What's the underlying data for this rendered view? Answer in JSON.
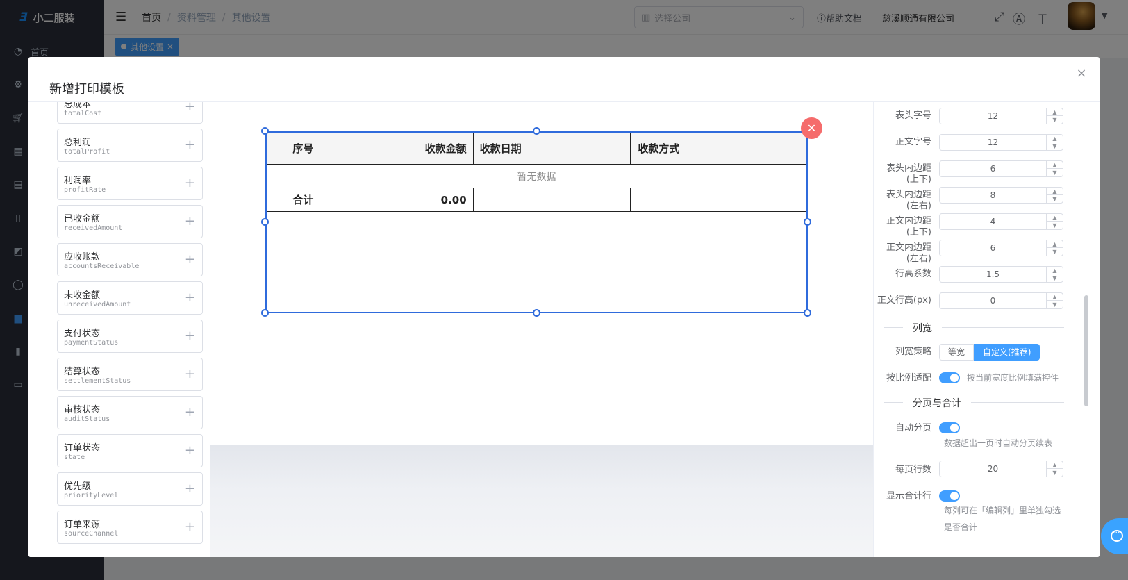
{
  "app": {
    "logo_mark": "Ǝ",
    "name": "小二服装"
  },
  "sidebar": {
    "first_item": "首页"
  },
  "breadcrumb": [
    "首页",
    "资料管理",
    "其他设置"
  ],
  "header": {
    "company_placeholder": "选择公司",
    "help_label": "帮助文档",
    "company_name": "慈溪顺通有限公司"
  },
  "tags": [
    {
      "label": "其他设置",
      "close": "×"
    }
  ],
  "dialog": {
    "title": "新增打印模板",
    "close": "×"
  },
  "fields": [
    {
      "label": "总成本",
      "key": "totalCost"
    },
    {
      "label": "总利润",
      "key": "totalProfit"
    },
    {
      "label": "利润率",
      "key": "profitRate"
    },
    {
      "label": "已收金额",
      "key": "receivedAmount"
    },
    {
      "label": "应收账款",
      "key": "accountsReceivable"
    },
    {
      "label": "未收金额",
      "key": "unreceivedAmount"
    },
    {
      "label": "支付状态",
      "key": "paymentStatus"
    },
    {
      "label": "结算状态",
      "key": "settlementStatus"
    },
    {
      "label": "审核状态",
      "key": "auditStatus"
    },
    {
      "label": "订单状态",
      "key": "state"
    },
    {
      "label": "优先级",
      "key": "priorityLevel"
    },
    {
      "label": "订单来源",
      "key": "sourceChannel"
    }
  ],
  "table": {
    "headers": [
      "序号",
      "收款金额",
      "收款日期",
      "收款方式"
    ],
    "empty_text": "暂无数据",
    "summary": [
      "合计",
      "0.00",
      "",
      ""
    ]
  },
  "settings": {
    "numeric": [
      {
        "label": "表头字号",
        "value": "12"
      },
      {
        "label": "正文字号",
        "value": "12"
      },
      {
        "label": "表头内边距(上下)",
        "value": "6"
      },
      {
        "label": "表头内边距(左右)",
        "value": "8"
      },
      {
        "label": "正文内边距(上下)",
        "value": "4"
      },
      {
        "label": "正文内边距(左右)",
        "value": "6"
      },
      {
        "label": "行高系数",
        "value": "1.5"
      },
      {
        "label": "正文行高(px)",
        "value": "0"
      }
    ],
    "column_width": {
      "divider": "列宽",
      "strategy_label": "列宽策略",
      "options": [
        "等宽",
        "自定义(推荐)"
      ],
      "selected": "自定义(推荐)",
      "ratio_label": "按比例适配",
      "ratio_on": true,
      "ratio_hint": "按当前宽度比例填满控件"
    },
    "paging": {
      "divider": "分页与合计",
      "auto_label": "自动分页",
      "auto_on": true,
      "auto_hint": "数据超出一页时自动分页续表",
      "rows_label": "每页行数",
      "rows_value": "20",
      "total_label": "显示合计行",
      "total_on": true,
      "total_hint_1": "每列可在「编辑列」里单独勾选",
      "total_hint_2": "是否合计"
    }
  },
  "colors": {
    "primary": "#409eff",
    "selection": "#2f6bdc",
    "danger": "#f56c6c",
    "sidebar": "#2b2f3a"
  }
}
